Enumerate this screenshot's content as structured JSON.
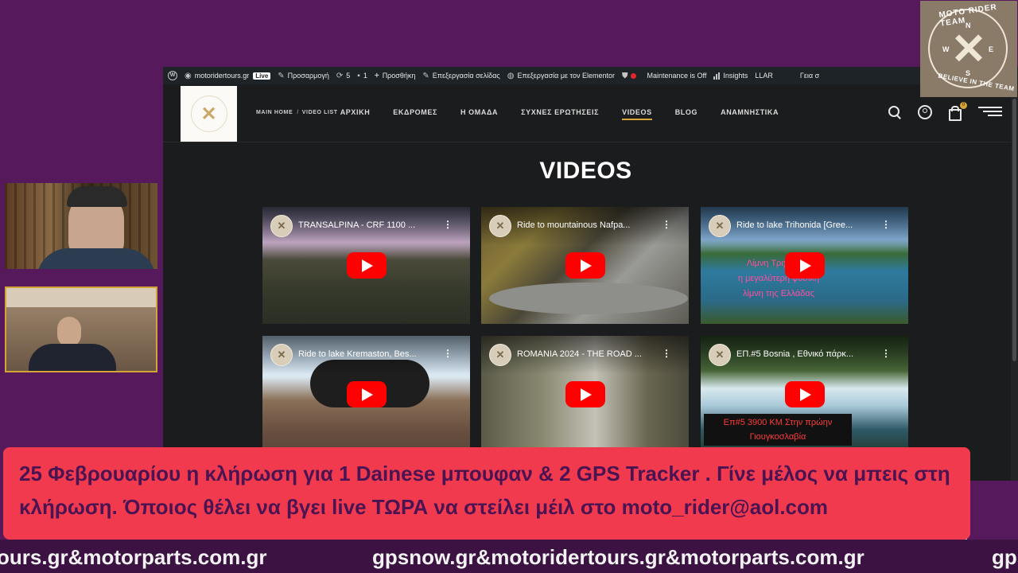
{
  "admin_bar": {
    "site": "motoridertours.gr",
    "live": "Live",
    "customize": "Προσαρμογή",
    "updates": "5",
    "comments": "1",
    "new": "Προσθήκη",
    "edit_page": "Επεξεργασία σελίδας",
    "edit_elementor": "Επεξεργασία με τον Elementor",
    "maintenance": "Maintenance is Off",
    "insights": "Insights",
    "llar": "LLAR",
    "greeting": "Γεια σ"
  },
  "header": {
    "breadcrumb_home": "MAIN HOME",
    "breadcrumb_sep": "/",
    "breadcrumb_current": "VIDEO LIST",
    "nav": [
      "ΑΡΧΙΚΗ",
      "ΕΚΔΡΟΜΕΣ",
      "Η ΟΜΑΔΑ",
      "ΣΥΧΝΕΣ ΕΡΩΤΗΣΕΙΣ",
      "VIDEOS",
      "BLOG",
      "ΑΝΑΜΝΗΣΤΙΚΑ"
    ],
    "active_nav": "VIDEOS",
    "cart_count": "0",
    "accent": "#d4a437"
  },
  "page": {
    "heading": "VIDEOS"
  },
  "videos": [
    {
      "title": "TRANSALPINA - CRF 1100 ..."
    },
    {
      "title": "Ride to mountainous Nafpa..."
    },
    {
      "title": "Ride to lake Trihonida [Gree...",
      "overlay": "Λίμνη Τριχωνίδα\nη μεγαλύτερη φυσική\nλίμνη της Ελλάδας"
    },
    {
      "title": "Ride to lake Kremaston, Bes..."
    },
    {
      "title": "ROMANIA 2024 - THE ROAD ..."
    },
    {
      "title": "ΕΠ.#5 Bosnia , Εθνικό πάρκ...",
      "overlay": "Επ#5 3900 ΚΜ Στην πρώην\nΓιουγκοσλαβία"
    }
  ],
  "team_logo": {
    "top": "MOTO RIDER TEAM",
    "bottom": "BELIEVE IN THE TEAM"
  },
  "banner": {
    "text": "25 Φεβρουαρίου η κλήρωση για 1 Dainese μπουφαν & 2 GPS Tracker . Γίνε μέλος να μπεις στη κλήρωση. Όποιος θέλει να βγει live ΤΩΡΑ να στείλει μέιλ στο moto_rider@aol.com"
  },
  "ticker": {
    "left": "ours.gr&motorparts.com.gr",
    "center": "gpsnow.gr&motoridertours.gr&motorparts.com.gr",
    "right": "gps"
  },
  "colors": {
    "background": "#561a5c",
    "banner": "#f23a4f",
    "banner_text": "#4a1452",
    "ticker_bg": "#3b1242"
  }
}
